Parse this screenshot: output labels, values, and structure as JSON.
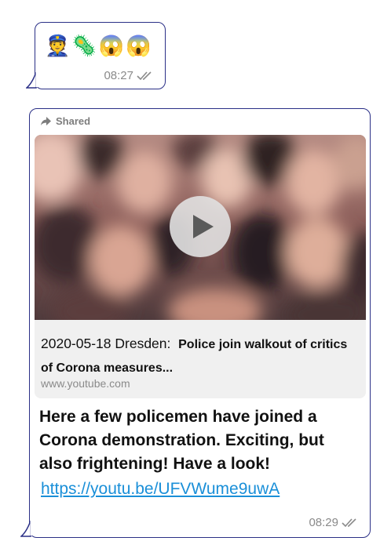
{
  "message1": {
    "emojis": "👮🦠😱😱",
    "emoji_icons": [
      "police-officer-emoji",
      "virus-emoji",
      "screaming-face-emoji",
      "screaming-face-emoji"
    ],
    "time": "08:27",
    "status_icon": "double-check-icon"
  },
  "message2": {
    "shared_label": "Shared",
    "shared_icon": "forward-arrow-icon",
    "preview": {
      "title_prefix": "2020-05-18 Dresden:",
      "title_bold": "Police join walkout of critics of Corona measures...",
      "domain": "www.youtube.com",
      "play_icon": "play-icon"
    },
    "text": "Here a few policemen have joined a Corona demonstration. Exciting, but also frightening! Have a look!",
    "link": "https://youtu.be/UFVWume9uwA",
    "time": "08:29",
    "status_icon": "double-check-icon"
  },
  "colors": {
    "bubble_border": "#2a2f86",
    "link": "#1a8fd8",
    "meta": "#8a8a8a",
    "preview_bg": "#f0f0f0"
  }
}
